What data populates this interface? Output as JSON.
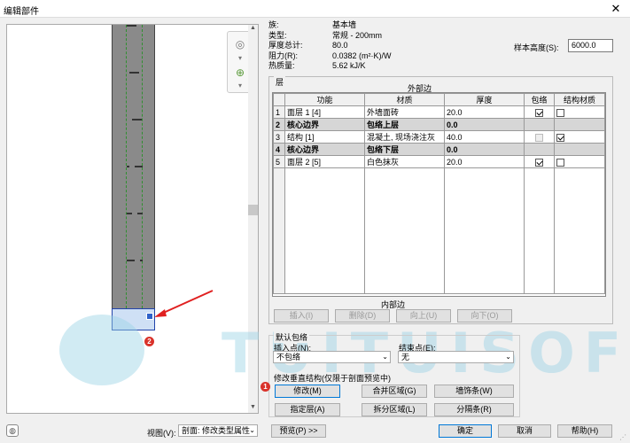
{
  "window": {
    "title": "编辑部件",
    "close_glyph": "✕"
  },
  "properties": [
    {
      "label": "族:",
      "value": "基本墙"
    },
    {
      "label": "类型:",
      "value": "常规 - 200mm"
    },
    {
      "label": "厚度总计:",
      "value": "80.0"
    },
    {
      "label": "阻力(R):",
      "value": "0.0382 (m²·K)/W"
    },
    {
      "label": "热质量:",
      "value": "5.62 kJ/K"
    }
  ],
  "sample": {
    "label": "样本高度(S):",
    "value": "6000.0"
  },
  "layers": {
    "group_label": "层",
    "outer_label": "外部边",
    "inner_label": "内部边",
    "headers": [
      "",
      "功能",
      "材质",
      "厚度",
      "包络",
      "结构材质"
    ],
    "rows": [
      {
        "idx": "1",
        "func": "面层 1 [4]",
        "mat": "外墙面砖",
        "thick": "20.0",
        "wrap": "on",
        "struct": "off",
        "core": false
      },
      {
        "idx": "2",
        "func": "核心边界",
        "mat": "包络上层",
        "thick": "0.0",
        "wrap": "",
        "struct": "",
        "core": true
      },
      {
        "idx": "3",
        "func": "结构 [1]",
        "mat": "混凝土, 现场浇注灰",
        "thick": "40.0",
        "wrap": "dis",
        "struct": "on",
        "core": false
      },
      {
        "idx": "4",
        "func": "核心边界",
        "mat": "包络下层",
        "thick": "0.0",
        "wrap": "",
        "struct": "",
        "core": true
      },
      {
        "idx": "5",
        "func": "面层 2 [5]",
        "mat": "白色抹灰",
        "thick": "20.0",
        "wrap": "on",
        "struct": "off",
        "core": false
      }
    ]
  },
  "layer_buttons": [
    "插入(I)",
    "删除(D)",
    "向上(U)",
    "向下(O)"
  ],
  "default_wrap": {
    "group_label": "默认包络",
    "insert_label": "插入点(N):",
    "insert_value": "不包络",
    "end_label": "结束点(E):",
    "end_value": "无"
  },
  "vertical": {
    "group_label": "修改垂直结构(仅限于剖面预览中)",
    "buttons": [
      "修改(M)",
      "合并区域(G)",
      "墙饰条(W)",
      "指定层(A)",
      "拆分区域(L)",
      "分隔条(R)"
    ]
  },
  "bottom": {
    "view_label": "视图(V):",
    "view_value": "剖面: 修改类型属性",
    "preview_btn": "预览(P) >>",
    "ok": "确定",
    "cancel": "取消",
    "help": "帮助(H)"
  },
  "badges": {
    "one": "1",
    "two": "2"
  },
  "watermark": "TUITUISOFT",
  "icons": [
    "zoom-icon",
    "nav-wheel-icon",
    "chevron-down-icon",
    "resize-grip-icon",
    "close-icon"
  ]
}
